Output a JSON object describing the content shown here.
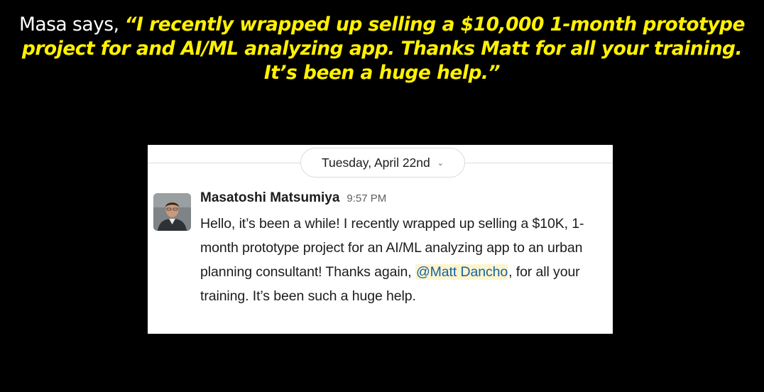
{
  "headline": {
    "lead": "Masa says, ",
    "quote": "“I recently wrapped up selling a $10,000 1-month prototype project for and AI/ML analyzing app. Thanks Matt for all your training. It’s been a huge help.”"
  },
  "slack": {
    "date_divider": "Tuesday, April 22nd",
    "chevron_icon": "chevron-down-icon",
    "message": {
      "author": "Masatoshi Matsumiya",
      "time": "9:57 PM",
      "text_before": "Hello, it’s been a while! I recently wrapped up selling a $10K, 1-month prototype project for an AI/ML analyzing app to an urban planning consultant! Thanks again, ",
      "mention": "@Matt Dancho",
      "text_after": ", for all your training. It’s been such a huge help."
    }
  },
  "colors": {
    "background": "#000000",
    "quote_yellow": "#fff200",
    "mention_blue": "#1264a3",
    "mention_bg": "#fdf4cf"
  }
}
